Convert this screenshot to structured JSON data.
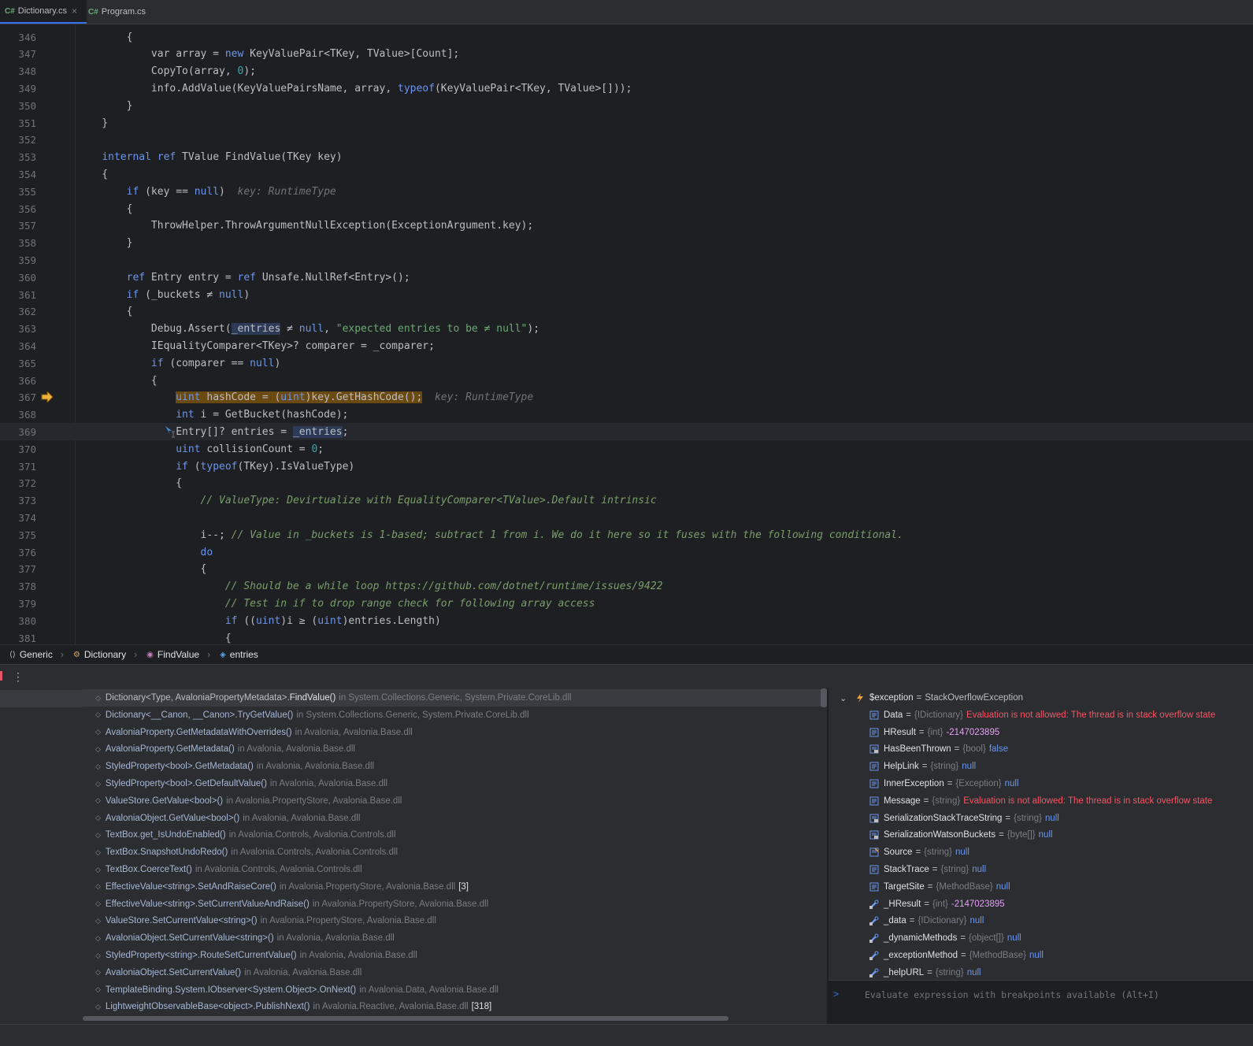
{
  "tabs": [
    {
      "lang": "C#",
      "label": "Dictionary.cs",
      "active": true
    },
    {
      "lang": "C#",
      "label": "Program.cs",
      "active": false
    }
  ],
  "editor": {
    "lines": [
      {
        "n": "346",
        "html": "        {"
      },
      {
        "n": "347",
        "html": "            var array = <span class=\"kwb\">new</span> KeyValuePair&lt;TKey, TValue&gt;[Count];"
      },
      {
        "n": "348",
        "html": "            CopyTo(array, <span class=\"num\">0</span>);"
      },
      {
        "n": "349",
        "html": "            info.AddValue(KeyValuePairsName, array, <span class=\"kwb\">typeof</span>(KeyValuePair&lt;TKey, TValue&gt;[]));"
      },
      {
        "n": "350",
        "html": "        }"
      },
      {
        "n": "351",
        "html": "    }"
      },
      {
        "n": "352",
        "html": ""
      },
      {
        "n": "353",
        "html": "    <span class=\"kwb\">internal ref</span> TValue FindValue(TKey key)"
      },
      {
        "n": "354",
        "html": "    {"
      },
      {
        "n": "355",
        "html": "        <span class=\"kwb\">if</span> (key == <span class=\"kwb\">null</span>)  <span class=\"hint\">key: RuntimeType</span>"
      },
      {
        "n": "356",
        "html": "        {"
      },
      {
        "n": "357",
        "html": "            ThrowHelper.ThrowArgumentNullException(ExceptionArgument.key);"
      },
      {
        "n": "358",
        "html": "        }"
      },
      {
        "n": "359",
        "html": ""
      },
      {
        "n": "360",
        "html": "        <span class=\"kwb\">ref</span> Entry entry = <span class=\"kwb\">ref</span> Unsafe.NullRef&lt;Entry&gt;();"
      },
      {
        "n": "361",
        "html": "        <span class=\"kwb\">if</span> (_buckets ≠ <span class=\"kwb\">null</span>)"
      },
      {
        "n": "362",
        "html": "        {"
      },
      {
        "n": "363",
        "html": "            Debug.Assert(<span class=\"hl-ref\">_entries</span> ≠ <span class=\"kwb\">null</span>, <span class=\"strq\">\"expected entries to be ≠ null\"</span>);"
      },
      {
        "n": "364",
        "html": "            IEqualityComparer&lt;TKey&gt;? comparer = _comparer;"
      },
      {
        "n": "365",
        "html": "            <span class=\"kwb\">if</span> (comparer == <span class=\"kwb\">null</span>)"
      },
      {
        "n": "366",
        "html": "            {"
      },
      {
        "n": "367",
        "html": "                <span class=\"hl-exec\"><span class=\"kwb\">uint</span> hashCode = (<span class=\"kwb\">uint</span>)key.GetHashCode();</span>  <span class=\"hint\">key: RuntimeType</span>",
        "exec": true
      },
      {
        "n": "368",
        "html": "                <span class=\"kwb\">int</span> i = GetBucket(hashCode);"
      },
      {
        "n": "369",
        "html": "                Entry[]? entries = <span class=\"hl-ref\">_entries</span>;",
        "current": true
      },
      {
        "n": "370",
        "html": "                <span class=\"kwb\">uint</span> collisionCount = <span class=\"num\">0</span>;"
      },
      {
        "n": "371",
        "html": "                <span class=\"kwb\">if</span> (<span class=\"kwb\">typeof</span>(TKey).IsValueType)"
      },
      {
        "n": "372",
        "html": "                {"
      },
      {
        "n": "373",
        "html": "                    <span class=\"cmt\">// ValueType: Devirtualize with EqualityComparer&lt;TValue&gt;.Default intrinsic</span>"
      },
      {
        "n": "374",
        "html": ""
      },
      {
        "n": "375",
        "html": "                    i--; <span class=\"cmt\">// Value in _buckets is 1-based; subtract 1 from i. We do it here so it fuses with the following conditional.</span>"
      },
      {
        "n": "376",
        "html": "                    <span class=\"kwb\">do</span>"
      },
      {
        "n": "377",
        "html": "                    {"
      },
      {
        "n": "378",
        "html": "                        <span class=\"cmt\">// Should be a while loop https://github.com/dotnet/runtime/issues/9422</span>"
      },
      {
        "n": "379",
        "html": "                        <span class=\"cmt\">// Test in if to drop range check for following array access</span>"
      },
      {
        "n": "380",
        "html": "                        <span class=\"kwb\">if</span> ((<span class=\"kwb\">uint</span>)i ≥ (<span class=\"kwb\">uint</span>)entries.Length)"
      },
      {
        "n": "381",
        "html": "                        {"
      }
    ]
  },
  "breadcrumb": [
    {
      "icon": "namespace-icon",
      "glyph": "⟨⟩",
      "label": "Generic"
    },
    {
      "icon": "class-icon",
      "glyph": "⚙",
      "label": "Dictionary"
    },
    {
      "icon": "method-icon",
      "glyph": "◉",
      "label": "FindValue"
    },
    {
      "icon": "variable-icon",
      "glyph": "◈",
      "label": "entries"
    }
  ],
  "frames": [
    {
      "cls": "Dictionary<Type, AvaloniaPropertyMetadata>.",
      "meth": "FindValue()",
      "in": "in System.Collections.Generic, System.Private.CoreLib.dll",
      "count": "",
      "sel": true
    },
    {
      "cls": "Dictionary<__Canon, __Canon>.",
      "meth": "TryGetValue()",
      "in": "in System.Collections.Generic, System.Private.CoreLib.dll",
      "count": ""
    },
    {
      "cls": "AvaloniaProperty.",
      "meth": "GetMetadataWithOverrides()",
      "in": "in Avalonia, Avalonia.Base.dll",
      "count": ""
    },
    {
      "cls": "AvaloniaProperty.",
      "meth": "GetMetadata()",
      "in": "in Avalonia, Avalonia.Base.dll",
      "count": ""
    },
    {
      "cls": "StyledProperty<bool>.",
      "meth": "GetMetadata()",
      "in": "in Avalonia, Avalonia.Base.dll",
      "count": ""
    },
    {
      "cls": "StyledProperty<bool>.",
      "meth": "GetDefaultValue()",
      "in": "in Avalonia, Avalonia.Base.dll",
      "count": ""
    },
    {
      "cls": "ValueStore.",
      "meth": "GetValue<bool>()",
      "in": "in Avalonia.PropertyStore, Avalonia.Base.dll",
      "count": ""
    },
    {
      "cls": "AvaloniaObject.",
      "meth": "GetValue<bool>()",
      "in": "in Avalonia, Avalonia.Base.dll",
      "count": ""
    },
    {
      "cls": "TextBox.",
      "meth": "get_IsUndoEnabled()",
      "in": "in Avalonia.Controls, Avalonia.Controls.dll",
      "count": ""
    },
    {
      "cls": "TextBox.",
      "meth": "SnapshotUndoRedo()",
      "in": "in Avalonia.Controls, Avalonia.Controls.dll",
      "count": ""
    },
    {
      "cls": "TextBox.",
      "meth": "CoerceText()",
      "in": "in Avalonia.Controls, Avalonia.Controls.dll",
      "count": ""
    },
    {
      "cls": "EffectiveValue<string>.",
      "meth": "SetAndRaiseCore()",
      "in": "in Avalonia.PropertyStore, Avalonia.Base.dll",
      "count": "[3]"
    },
    {
      "cls": "EffectiveValue<string>.",
      "meth": "SetCurrentValueAndRaise()",
      "in": "in Avalonia.PropertyStore, Avalonia.Base.dll",
      "count": ""
    },
    {
      "cls": "ValueStore.",
      "meth": "SetCurrentValue<string>()",
      "in": "in Avalonia.PropertyStore, Avalonia.Base.dll",
      "count": ""
    },
    {
      "cls": "AvaloniaObject.",
      "meth": "SetCurrentValue<string>()",
      "in": "in Avalonia, Avalonia.Base.dll",
      "count": ""
    },
    {
      "cls": "StyledProperty<string>.",
      "meth": "RouteSetCurrentValue()",
      "in": "in Avalonia, Avalonia.Base.dll",
      "count": ""
    },
    {
      "cls": "AvaloniaObject.",
      "meth": "SetCurrentValue()",
      "in": "in Avalonia, Avalonia.Base.dll",
      "count": ""
    },
    {
      "cls": "TemplateBinding.",
      "meth": "System.IObserver<System.Object>.OnNext()",
      "in": "in Avalonia.Data, Avalonia.Base.dll",
      "count": ""
    },
    {
      "cls": "LightweightObservableBase<object>.",
      "meth": "PublishNext()",
      "in": "in Avalonia.Reactive, Avalonia.Base.dll",
      "count": "[318]"
    }
  ],
  "variables": [
    {
      "kind": "exception",
      "name": "$exception",
      "type": "",
      "value": "StackOverflowException",
      "style": "plain",
      "expanded": true
    },
    {
      "kind": "prop",
      "name": "Data",
      "type": "{IDictionary}",
      "value": "Evaluation is not allowed: The thread is in stack overflow state",
      "style": "err"
    },
    {
      "kind": "prop",
      "name": "HResult",
      "type": "{int}",
      "value": "-2147023895",
      "style": "num"
    },
    {
      "kind": "prop-lock",
      "name": "HasBeenThrown",
      "type": "{bool}",
      "value": "false",
      "style": "kw"
    },
    {
      "kind": "prop",
      "name": "HelpLink",
      "type": "{string}",
      "value": "null",
      "style": "kw"
    },
    {
      "kind": "prop",
      "name": "InnerException",
      "type": "{Exception}",
      "value": "null",
      "style": "kw"
    },
    {
      "kind": "prop",
      "name": "Message",
      "type": "{string}",
      "value": "Evaluation is not allowed: The thread is in stack overflow state",
      "style": "err"
    },
    {
      "kind": "prop-lock",
      "name": "SerializationStackTraceString",
      "type": "{string}",
      "value": "null",
      "style": "kw"
    },
    {
      "kind": "prop-lock",
      "name": "SerializationWatsonBuckets",
      "type": "{byte[]}",
      "value": "null",
      "style": "kw"
    },
    {
      "kind": "prop-write",
      "name": "Source",
      "type": "{string}",
      "value": "null",
      "style": "kw"
    },
    {
      "kind": "prop",
      "name": "StackTrace",
      "type": "{string}",
      "value": "null",
      "style": "kw"
    },
    {
      "kind": "prop",
      "name": "TargetSite",
      "type": "{MethodBase}",
      "value": "null",
      "style": "kw"
    },
    {
      "kind": "field",
      "name": "_HResult",
      "type": "{int}",
      "value": "-2147023895",
      "style": "num"
    },
    {
      "kind": "field",
      "name": "_data",
      "type": "{IDictionary}",
      "value": "null",
      "style": "kw"
    },
    {
      "kind": "field",
      "name": "_dynamicMethods",
      "type": "{object[]}",
      "value": "null",
      "style": "kw"
    },
    {
      "kind": "field",
      "name": "_exceptionMethod",
      "type": "{MethodBase}",
      "value": "null",
      "style": "kw"
    },
    {
      "kind": "field",
      "name": "_helpURL",
      "type": "{string}",
      "value": "null",
      "style": "kw"
    }
  ],
  "eval": {
    "prompt": ">",
    "placeholder": "Evaluate expression with breakpoints available (Alt+I)"
  },
  "colors": {
    "accent": "#3574f0",
    "exec_highlight": "#6b4a12",
    "error": "#f75464"
  }
}
